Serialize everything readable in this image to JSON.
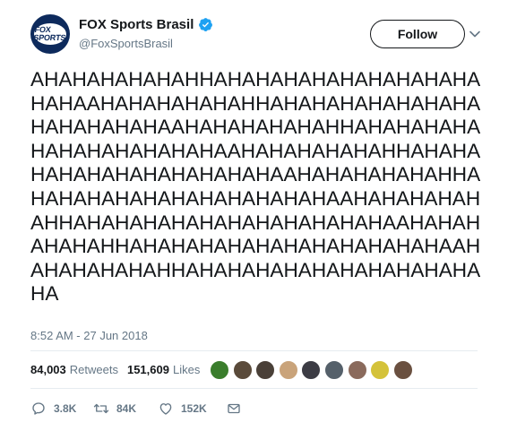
{
  "account": {
    "name": "FOX Sports Brasil",
    "handle": "@FoxSportsBrasil",
    "avatar_text": "FOX SPORTS",
    "verified": true,
    "brand_color": "#0d2a5c",
    "verified_color": "#1da1f2"
  },
  "follow_label": "Follow",
  "tweet_lines": [
    "AHAHAHAHAHAHHAHAHAHAHAHAHAHAHAHA",
    "HAHAAHAHAHAHAHAHHAHAHAHAHAHAHAHA",
    "HAHAHAHAHAAHAHAHAHAHAHHAHAHAHAHA",
    "HAHAHAHAHAHAHAAHAHAHAHAHAHHAHAHA",
    "HAHAHAHAHAHAHAHAHAAHAHAHAHAHAHHA",
    "HAHAHAHAHAHAHAHAHAHAHAAHAHAHAHAH",
    "AHHAHAHAHAHAHAHAHAHAHAHAHAAHAHAH",
    "AHAHAHHAHAHAHAHAHAHAHAHAHAHAHAAH",
    "AHAHAHAHAHHAHAHAHAHAHAHAHAHAHAHA",
    "HA"
  ],
  "timestamp": "8:52 AM - 27 Jun 2018",
  "stats": {
    "retweets_count": "84,003",
    "retweets_label": "Retweets",
    "likes_count": "151,609",
    "likes_label": "Likes"
  },
  "liker_avatars": [
    {
      "icon": "liker-avatar",
      "color": "#3a7d2c"
    },
    {
      "icon": "liker-avatar",
      "color": "#5a4a3a"
    },
    {
      "icon": "liker-avatar",
      "color": "#4a4038"
    },
    {
      "icon": "liker-avatar",
      "color": "#c9a37a"
    },
    {
      "icon": "liker-avatar",
      "color": "#3c3c44"
    },
    {
      "icon": "liker-avatar",
      "color": "#55606a"
    },
    {
      "icon": "liker-avatar",
      "color": "#8a6a5c"
    },
    {
      "icon": "liker-avatar",
      "color": "#d4c23a"
    },
    {
      "icon": "liker-avatar",
      "color": "#6a5040"
    }
  ],
  "actions": {
    "reply_count": "3.8K",
    "retweet_count": "84K",
    "like_count": "152K"
  }
}
